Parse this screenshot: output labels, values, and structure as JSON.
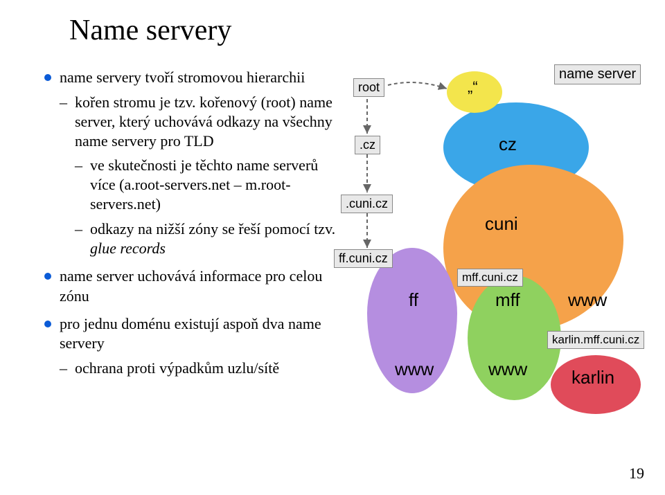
{
  "title": "Name servery",
  "bullets": {
    "b1": "name servery tvoří stromovou hierarchii",
    "b1_1": "kořen stromu je tzv. kořenový (root) name server, který uchovává odkazy na všechny name servery pro TLD",
    "b1_1_1": "ve skutečnosti je těchto name serverů více (a.root-servers.net – m.root-servers.net)",
    "b1_1_2a": "odkazy na nižší zóny se řeší pomocí tzv. ",
    "b1_1_2b": "glue records",
    "b2": "name server uchovává informace pro celou zónu",
    "b3": "pro jednu doménu existují aspoň dva name servery",
    "b3_1": "ochrana proti výpadkům uzlu/sítě"
  },
  "diagram": {
    "root_box": "root",
    "cz_box": ".cz",
    "cunicz_box": ".cuni.cz",
    "ffcunicz_box": "ff.cuni.cz",
    "mffcunicz_box": "mff.cuni.cz",
    "karlinmff_box": "karlin.mff.cuni.cz",
    "name_server_box": "name server",
    "quote_top": "„“",
    "cz": "cz",
    "cuni": "cuni",
    "ff": "ff",
    "mff": "mff",
    "www_orange": "www",
    "www_purple": "www",
    "www_green": "www",
    "karlin": "karlin"
  },
  "page": "19",
  "colors": {
    "blue": "#3aa6e8",
    "orange": "#f5a24a",
    "purple": "#b58ee0",
    "green": "#8fd15f",
    "yellow": "#f3e54c",
    "red": "#e04b5a"
  }
}
